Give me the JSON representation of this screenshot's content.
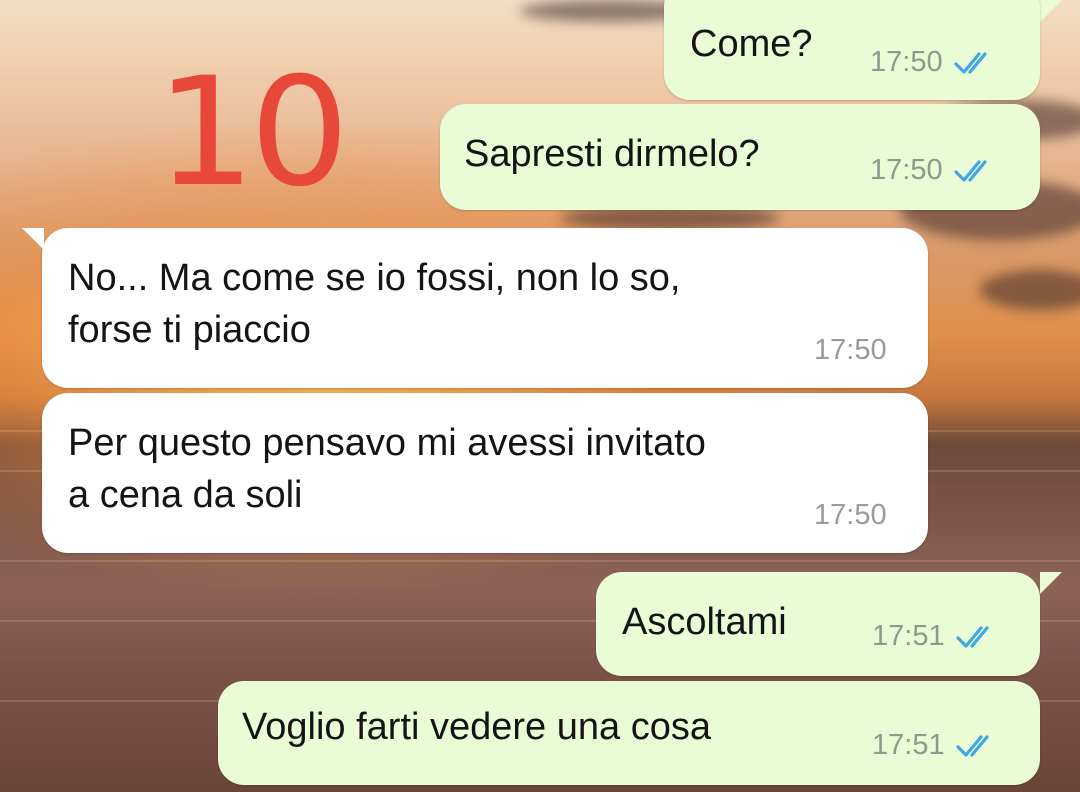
{
  "annotation": {
    "number": "10",
    "color": "#e8483a"
  },
  "colors": {
    "outgoing_bubble": "#e9fcd6",
    "incoming_bubble": "#ffffff",
    "read_ticks": "#3fa6e8"
  },
  "messages": [
    {
      "direction": "outgoing",
      "text": "Come?",
      "time": "17:50",
      "status": "read",
      "status_icon": "double-check-icon"
    },
    {
      "direction": "outgoing",
      "text": "Sapresti dirmelo?",
      "time": "17:50",
      "status": "read",
      "status_icon": "double-check-icon"
    },
    {
      "direction": "incoming",
      "text": "No... Ma come se io fossi, non lo so,\nforse ti piaccio",
      "time": "17:50"
    },
    {
      "direction": "incoming",
      "text": "Per questo pensavo mi avessi invitato\na cena da soli",
      "time": "17:50"
    },
    {
      "direction": "outgoing",
      "text": "Ascoltami",
      "time": "17:51",
      "status": "read",
      "status_icon": "double-check-icon"
    },
    {
      "direction": "outgoing",
      "text": "Voglio farti vedere una cosa",
      "time": "17:51",
      "status": "read",
      "status_icon": "double-check-icon"
    }
  ]
}
